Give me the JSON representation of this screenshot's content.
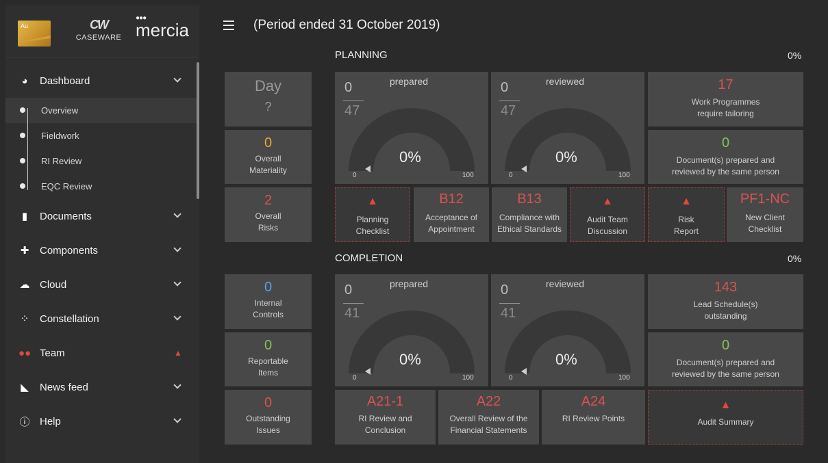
{
  "brand": {
    "au": "Au",
    "caseware": "CASEWARE",
    "mercia": "mercia"
  },
  "header": {
    "period": "(Period ended 31 October 2019)"
  },
  "sidebar": {
    "dashboard": "Dashboard",
    "sub": [
      "Overview",
      "Fieldwork",
      "RI Review",
      "EQC Review"
    ],
    "documents": "Documents",
    "components": "Components",
    "cloud": "Cloud",
    "constellation": "Constellation",
    "team": "Team",
    "newsfeed": "News feed",
    "help": "Help"
  },
  "planning": {
    "title": "PLANNING",
    "pct": "0%",
    "day": {
      "big": "Day",
      "q": "?"
    },
    "materiality": {
      "value": "0",
      "label1": "Overall",
      "label2": "Materiality"
    },
    "risks": {
      "value": "2",
      "label1": "Overall",
      "label2": "Risks"
    },
    "prepared": {
      "label": "prepared",
      "num": "0",
      "den": "47",
      "pct": "0%",
      "min": "0",
      "max": "100"
    },
    "reviewed": {
      "label": "reviewed",
      "num": "0",
      "den": "47",
      "pct": "0%",
      "min": "0",
      "max": "100"
    },
    "workprog": {
      "value": "17",
      "label1": "Work Programmes",
      "label2": "require tailoring"
    },
    "sameperson": {
      "value": "0",
      "label1": "Document(s) prepared and",
      "label2": "reviewed by the same person"
    },
    "tiles": [
      {
        "code": "",
        "l1": "Planning",
        "l2": "Checklist"
      },
      {
        "code": "B12",
        "l1": "Acceptance of",
        "l2": "Appointment"
      },
      {
        "code": "B13",
        "l1": "Compliance with",
        "l2": "Ethical Standards"
      },
      {
        "code": "",
        "l1": "Audit Team",
        "l2": "Discussion"
      },
      {
        "code": "",
        "l1": "Risk",
        "l2": "Report"
      },
      {
        "code": "PF1-NC",
        "l1": "New Client",
        "l2": "Checklist"
      }
    ]
  },
  "completion": {
    "title": "COMPLETION",
    "pct": "0%",
    "internal": {
      "value": "0",
      "label1": "Internal",
      "label2": "Controls"
    },
    "reportable": {
      "value": "0",
      "label1": "Reportable",
      "label2": "Items"
    },
    "outstanding": {
      "value": "0",
      "label1": "Outstanding",
      "label2": "Issues"
    },
    "prepared": {
      "label": "prepared",
      "num": "0",
      "den": "41",
      "pct": "0%",
      "min": "0",
      "max": "100"
    },
    "reviewed": {
      "label": "reviewed",
      "num": "0",
      "den": "41",
      "pct": "0%",
      "min": "0",
      "max": "100"
    },
    "lead": {
      "value": "143",
      "label1": "Lead Schedule(s)",
      "label2": "outstanding"
    },
    "sameperson": {
      "value": "0",
      "label1": "Document(s) prepared and",
      "label2": "reviewed by the same person"
    },
    "tiles": [
      {
        "code": "A21-1",
        "l1": "RI Review and",
        "l2": "Conclusion"
      },
      {
        "code": "A22",
        "l1": "Overall Review of the",
        "l2": "Financial Statements"
      },
      {
        "code": "A24",
        "l1": "RI Review Points",
        "l2": ""
      },
      {
        "code": "",
        "l1": "Audit Summary",
        "l2": ""
      }
    ]
  }
}
